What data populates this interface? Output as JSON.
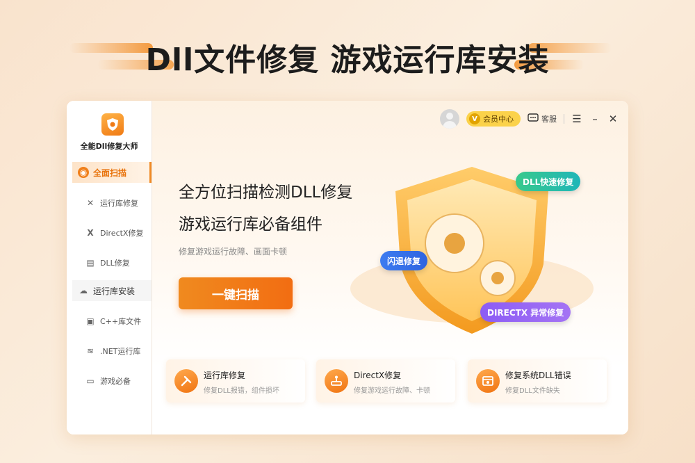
{
  "banner": {
    "headline": "Dll文件修复 游戏运行库安装"
  },
  "sidebar": {
    "app_name": "全能Dll修复大师",
    "items": [
      {
        "label": "全面扫描",
        "icon": "scan-icon"
      },
      {
        "label": "运行库修复",
        "icon": "tools-icon"
      },
      {
        "label": "DirectX修复",
        "icon": "directx-icon"
      },
      {
        "label": "DLL修复",
        "icon": "dll-file-icon"
      },
      {
        "label": "运行库安装",
        "icon": "cloud-icon"
      },
      {
        "label": "C++库文件",
        "icon": "monitor-icon"
      },
      {
        "label": ".NET运行库",
        "icon": "database-icon"
      },
      {
        "label": "游戏必备",
        "icon": "gamepad-icon"
      }
    ]
  },
  "topbar": {
    "vip_label": "会员中心",
    "service_label": "客服"
  },
  "hero": {
    "title_line1": "全方位扫描检测DLL修复",
    "title_line2": "游戏运行库必备组件",
    "subtitle": "修复游戏运行故障、画面卡顿",
    "scan_button": "一键扫描",
    "badges": {
      "dll": "DLL快速修复",
      "flash": "闪退修复",
      "directx": "DIRECTX 异常修复"
    }
  },
  "cards": [
    {
      "title": "运行库修复",
      "desc": "修复DLL报错，组件损坏",
      "icon": "tools-icon"
    },
    {
      "title": "DirectX修复",
      "desc": "修复游戏运行故障、卡顿",
      "icon": "joystick-icon"
    },
    {
      "title": "修复系统DLL错误",
      "desc": "修复DLL文件缺失",
      "icon": "system-icon"
    }
  ],
  "colors": {
    "accent": "#f07f1a",
    "dll_badge": "#2ec2a2",
    "flash_badge": "#3a74ee",
    "directx_badge": "#9866f5"
  }
}
